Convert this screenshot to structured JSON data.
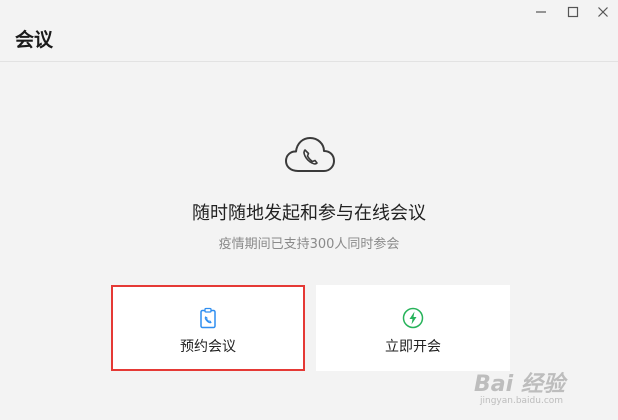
{
  "window": {
    "title": "会议",
    "controls": {
      "minimize_icon": "minimize-icon",
      "maximize_icon": "maximize-icon",
      "close_icon": "close-icon"
    }
  },
  "main": {
    "icon": "cloud-phone-icon",
    "headline": "随时随地发起和参与在线会议",
    "subline": "疫情期间已支持300人同时参会"
  },
  "cards": {
    "schedule": {
      "label": "预约会议",
      "icon": "clipboard-phone-icon",
      "icon_color": "#2f8ef0"
    },
    "instant": {
      "label": "立即开会",
      "icon": "lightning-icon",
      "icon_color": "#27b35a"
    }
  },
  "watermark": {
    "text": "Bai 经验",
    "sub": "jingyan.baidu.com"
  },
  "colors": {
    "background": "#f3f3f3",
    "highlight_border": "#e53935"
  }
}
